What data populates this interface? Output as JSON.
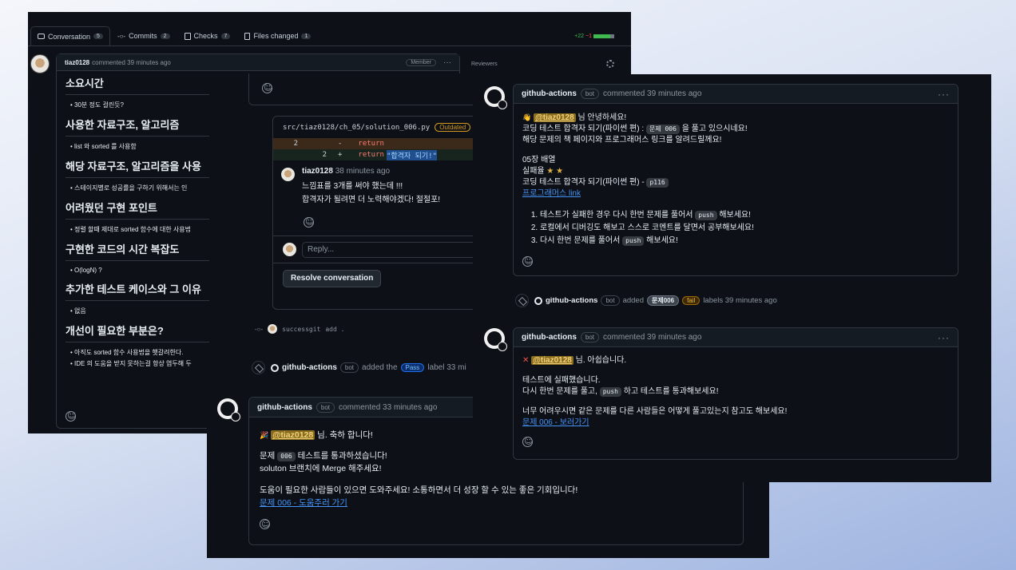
{
  "s1": {
    "tabs": [
      {
        "label": "Conversation",
        "count": "5"
      },
      {
        "label": "Commits",
        "count": "2"
      },
      {
        "label": "Checks",
        "count": "7"
      },
      {
        "label": "Files changed",
        "count": "1"
      }
    ],
    "diffstat": {
      "add": "+22",
      "del": "−1"
    },
    "comment_author": "tiaz0128",
    "comment_meta": "commented 39 minutes ago",
    "member_badge": "Member",
    "sections": [
      {
        "heading": "소요시간",
        "item": "30분 정도 걸린듯?"
      },
      {
        "heading": "사용한 자료구조, 알고리즘",
        "item": "list 와 sorted 를 사용함"
      },
      {
        "heading": "해당 자료구조, 알고리즘을 사용",
        "item": "스테이지별로 성공률을 구하기 위해서는 인"
      },
      {
        "heading": "어려웠던 구현 포인트",
        "item": "정렬 할때 제대로 sorted 함수에 대한 사용법"
      },
      {
        "heading": "구현한 코드의 시간 복잡도",
        "item": "O(logN) ?"
      },
      {
        "heading": "추가한 테스트 케이스와 그 이유",
        "item": "없음"
      }
    ],
    "last_heading": "개선이 필요한 부분은?",
    "last_items": [
      "아직도 sorted 함수 사용법을 햇갈려한다.",
      "IDE 의 도움을 받지 못하는걸 항상 염두해 두"
    ],
    "reviewers_label": "Reviewers",
    "file_path": "src/tiaz0128/ch_05/solution_006.py",
    "outdated": "Outdated",
    "diff": [
      {
        "num": "2",
        "sign": "-",
        "code": "return"
      },
      {
        "num": "2",
        "sign": "+",
        "code": "return",
        "highlight": "\"합격자 되기!\""
      }
    ],
    "review_author": "tiaz0128",
    "review_time": "38 minutes ago",
    "review_lines": [
      "느낌표를 3개를 써야 했는데 !!!",
      "합격자가 될려면 더 노력해야겠다! 절절포!"
    ],
    "reply_placeholder": "Reply...",
    "resolve": "Resolve conversation",
    "commit_name": "successgit",
    "commit_msg": "add .",
    "label_event": {
      "actor": "github-actions",
      "bot": "bot",
      "text": "added the",
      "label": "Pass",
      "after": "label 33 mi"
    }
  },
  "s2": {
    "author": "github-actions",
    "bot": "bot",
    "meta": "commented 33 minutes ago",
    "mention": "@tiaz0128",
    "greet_after": "님. 축하 합니다!",
    "line1_pre": "문제",
    "chip": "006",
    "line1_post": "테스트를 통과하셨습니다!",
    "line2": "soluton 브랜치에 Merge 해주세요!",
    "line3": "도움이 필요한 사람들이 있으면 도와주세요! 소통하면서 더 성장 할 수 있는 좋은 기회입니다!",
    "link": "문제 006 - 도움주러 가기"
  },
  "s3": {
    "c1": {
      "author": "github-actions",
      "bot": "bot",
      "meta": "commented 39 minutes ago",
      "mention": "@tiaz0128",
      "greet": "님 안녕하세요!",
      "line1_pre": "코딩 테스트 합격자 되기(파이썬 편) :",
      "chip1": "문제 006",
      "line1_post": "을 풀고 있으시네요!",
      "line2": "해당 문제의 책 페이지와 프로그래머스 링크를 알려드릴께요!",
      "line3": "05장 배열",
      "line4": "실패율",
      "line5_pre": "코딩 테스트 합격자 되기(파이썬 편) -",
      "chip2": "p116",
      "link": "프로그래머스 link",
      "ol": [
        {
          "pre": "테스트가 실패한 경우 다시 한번 문제를 풀어서",
          "chip": "push",
          "post": "해보세요!"
        },
        {
          "pre": "로컬에서 디버깅도 해보고 스스로 코멘트를 달면서 공부해보세요!",
          "chip": "",
          "post": ""
        },
        {
          "pre": "다시 한번 문제를 풀어서",
          "chip": "push",
          "post": "해보세요!"
        }
      ]
    },
    "label_event": {
      "actor": "github-actions",
      "bot": "bot",
      "text": "added",
      "label1": "문제006",
      "label2": "fail",
      "after": "labels 39 minutes ago"
    },
    "c2": {
      "author": "github-actions",
      "bot": "bot",
      "meta": "commented 39 minutes ago",
      "mention": "@tiaz0128",
      "greet": "님. 아쉽습니다.",
      "line1": "테스트에 실패했습니다.",
      "line2_pre": "다시 한번 문제를 풀고,",
      "chip": "push",
      "line2_post": "하고 테스트를 통과해보세요!",
      "line3": "너무 어려우시면 같은 문제를 다른 사람들은 어떻게 풀고있는지 참고도 해보세요!",
      "link": "문제 006 - 보러가기"
    }
  }
}
